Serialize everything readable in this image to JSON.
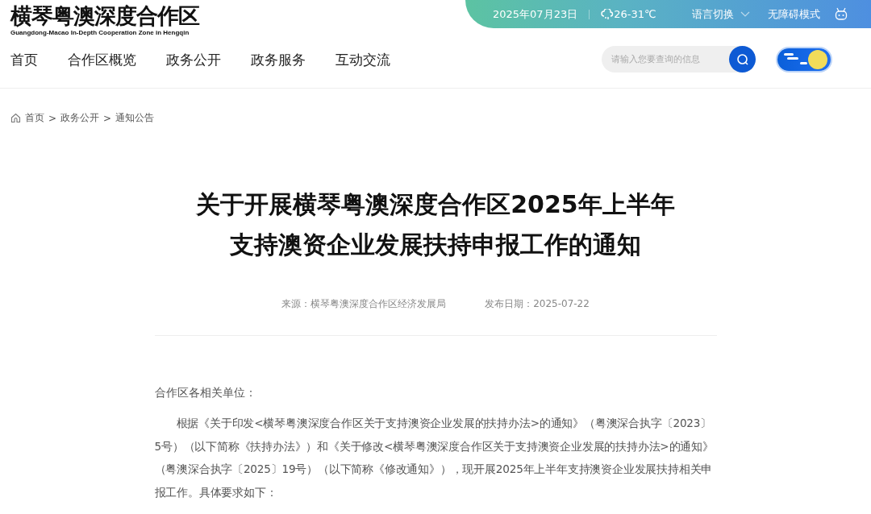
{
  "logo": {
    "title": "横琴粤澳深度合作区",
    "subtitle": "Guangdong-Macao In-Depth Cooperation Zone in Hengqin"
  },
  "top_bar": {
    "date": "2025年07月23日",
    "weather": "26-31℃",
    "language": "语言切换",
    "accessibility": "无障碍模式"
  },
  "nav": [
    {
      "label": "首页"
    },
    {
      "label": "合作区概览"
    },
    {
      "label": "政务公开"
    },
    {
      "label": "政务服务"
    },
    {
      "label": "互动交流"
    }
  ],
  "search": {
    "placeholder": "请输入您要查询的信息"
  },
  "theme_toggle": {
    "on": true
  },
  "breadcrumb": [
    "首页",
    "政务公开",
    "通知公告"
  ],
  "breadcrumb_separators": [
    ">",
    ">"
  ],
  "article": {
    "title_lines": [
      "关于开展横琴粤澳深度合作区2025年上半年",
      "支持澳资企业发展扶持申报工作的通知"
    ],
    "source": "来源：横琴粤澳深度合作区经济发展局",
    "date": "发布日期：2025-07-22",
    "salutation": "合作区各相关单位：",
    "paragraphs": [
      "根据《关于印发<横琴粤澳深度合作区关于支持澳资企业发展的扶持办法>的通知》（粤澳深合执字〔2023〕5号）（以下简称《扶持办法》）和《关于修改<横琴粤澳深度合作区关于支持澳资企业发展的扶持办法>的通知》（粤澳深合执字〔2025〕19号）（以下简称《修改通知》），现开展2025年上半年支持澳资企业发展扶持相关申报工作。具体要求如下："
    ]
  }
}
